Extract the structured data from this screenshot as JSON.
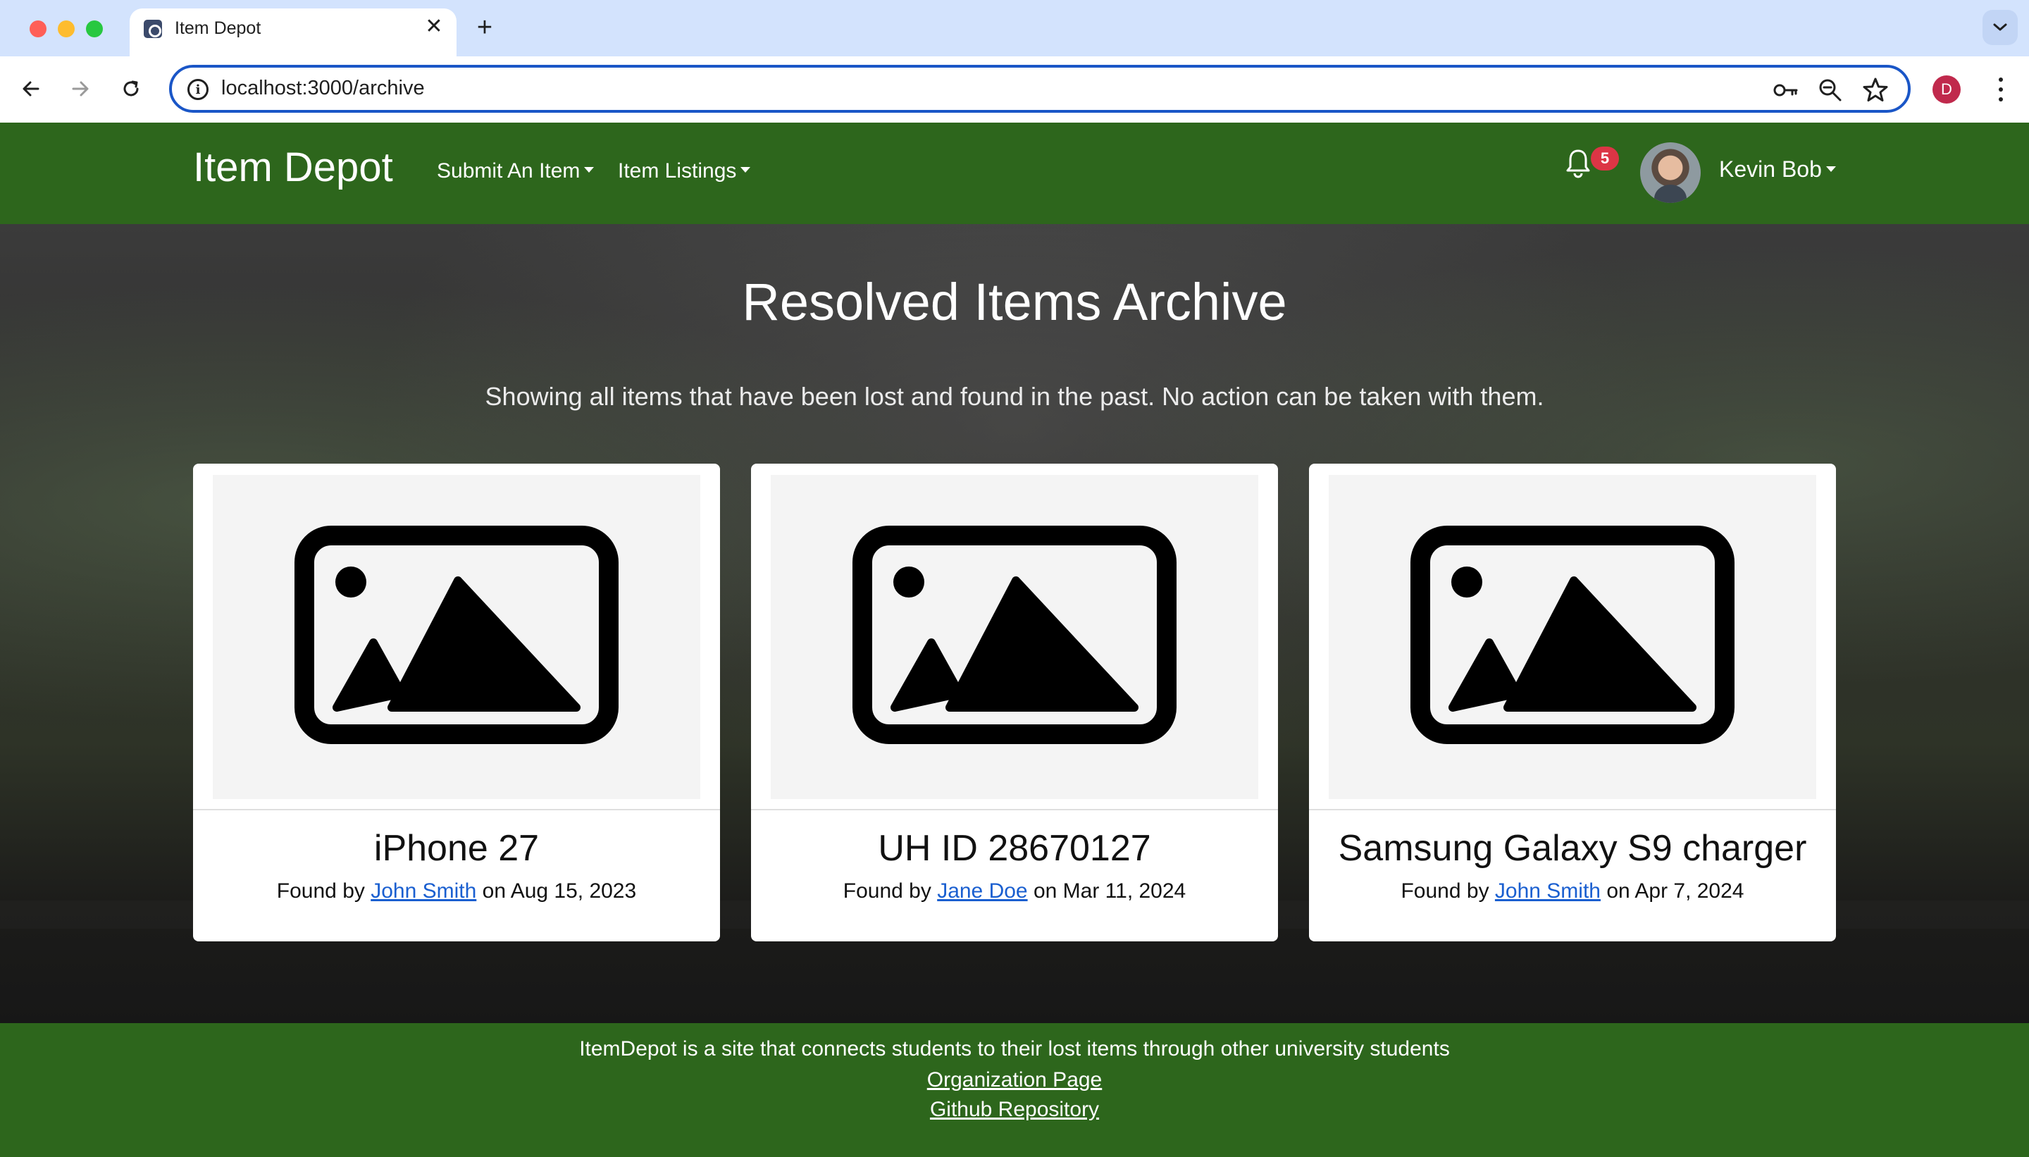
{
  "browser": {
    "tab_title": "Item Depot",
    "url": "localhost:3000/archive",
    "profile_initial": "D",
    "icons": [
      "back-icon",
      "forward-icon",
      "reload-icon",
      "site-info-icon",
      "key-icon",
      "zoom-icon",
      "bookmark-star-icon",
      "menu-kebab-icon",
      "tab-search-icon"
    ]
  },
  "navbar": {
    "brand": "Item Depot",
    "submit_menu": "Submit An Item",
    "listings_menu": "Item Listings",
    "notifications_count": "5",
    "user_name": "Kevin Bob",
    "colors": {
      "navbar_bg": "#2d661c",
      "badge": "#dc3545"
    }
  },
  "hero": {
    "title": "Resolved Items Archive",
    "subtitle": "Showing all items that have been lost and found in the past. No action can be taken with them."
  },
  "items": [
    {
      "name": "iPhone 27",
      "found_by_prefix": "Found by ",
      "finder": "John Smith",
      "date_prefix": " on ",
      "date": "Aug 15, 2023"
    },
    {
      "name": "UH ID 28670127",
      "found_by_prefix": "Found by ",
      "finder": "Jane Doe",
      "date_prefix": " on ",
      "date": "Mar 11, 2024"
    },
    {
      "name": "Samsung Galaxy S9 charger",
      "found_by_prefix": "Found by ",
      "finder": "John Smith",
      "date_prefix": " on ",
      "date": "Apr 7, 2024"
    }
  ],
  "footer": {
    "description": "ItemDepot is a site that connects students to their lost items through other university students",
    "org_link": "Organization Page",
    "repo_link": "Github Repository"
  }
}
